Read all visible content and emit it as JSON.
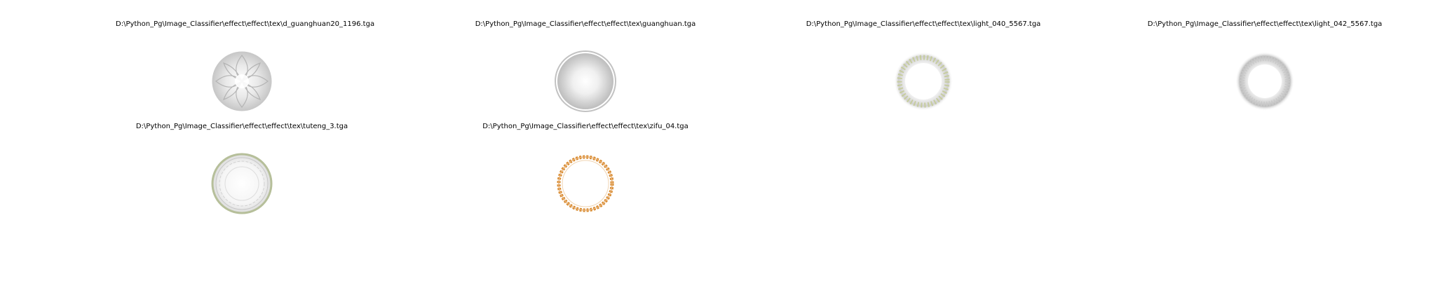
{
  "figure": {
    "images": [
      {
        "title": "D:\\Python_Pg\\Image_Classifier\\effect\\effect\\tex\\d_guanghuan20_1196.tga",
        "icon": "flower-ring-texture"
      },
      {
        "title": "D:\\Python_Pg\\Image_Classifier\\effect\\effect\\tex\\guanghuan.tga",
        "icon": "soft-halo-texture"
      },
      {
        "title": "D:\\Python_Pg\\Image_Classifier\\effect\\effect\\tex\\light_040_5567.tga",
        "icon": "spiky-light-ring-texture"
      },
      {
        "title": "D:\\Python_Pg\\Image_Classifier\\effect\\effect\\tex\\light_042_5567.tga",
        "icon": "gray-light-ring-texture"
      },
      {
        "title": "D:\\Python_Pg\\Image_Classifier\\effect\\effect\\tex\\tuteng_3.tga",
        "icon": "totem-ring-texture"
      },
      {
        "title": "D:\\Python_Pg\\Image_Classifier\\effect\\effect\\tex\\zifu_04.tga",
        "icon": "orange-rune-ring-texture"
      }
    ],
    "colors": {
      "background": "#ffffff",
      "text": "#000000",
      "gray_ring": "#b8b8b8",
      "olive_ring": "#b6bf9a",
      "orange_ring": "#d88a2e"
    }
  }
}
